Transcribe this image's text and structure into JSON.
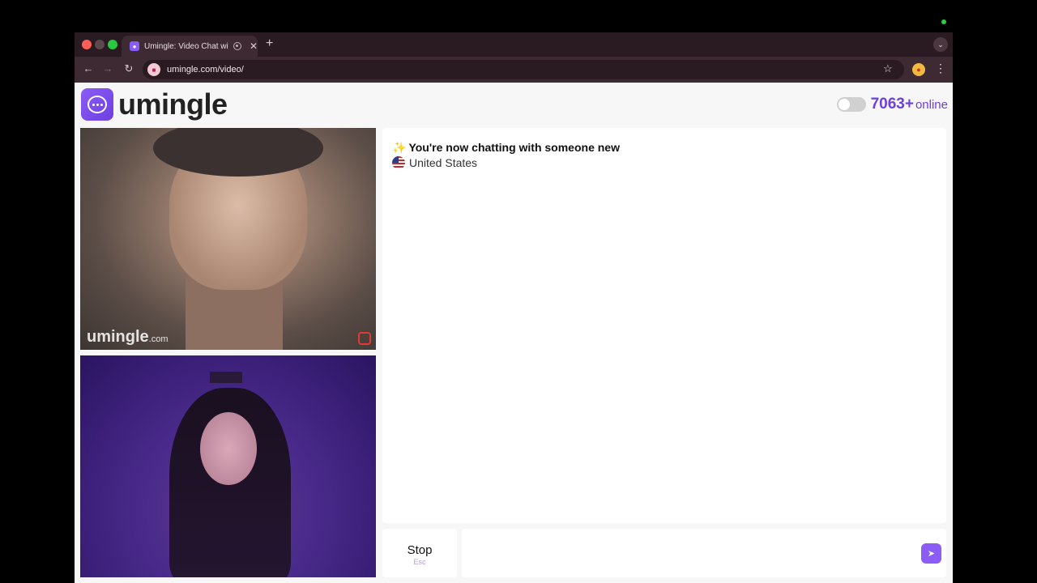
{
  "browser": {
    "tab_title": "Umingle: Video Chat with",
    "url": "umingle.com/video/",
    "new_tab_label": "+",
    "tab_close_label": "✕"
  },
  "header": {
    "logo_text": "umingle",
    "online_count": "7063+",
    "online_label": "online"
  },
  "video_top": {
    "watermark": "umingle",
    "watermark_suffix": ".com"
  },
  "chat": {
    "status_message": "You're now chatting with someone new",
    "country": "United States"
  },
  "controls": {
    "stop_label": "Stop",
    "stop_hint": "Esc",
    "message_placeholder": ""
  },
  "colors": {
    "brand": "#6d3fe0",
    "tabbar": "#2a1a22",
    "toolbar": "#3d2a33"
  }
}
